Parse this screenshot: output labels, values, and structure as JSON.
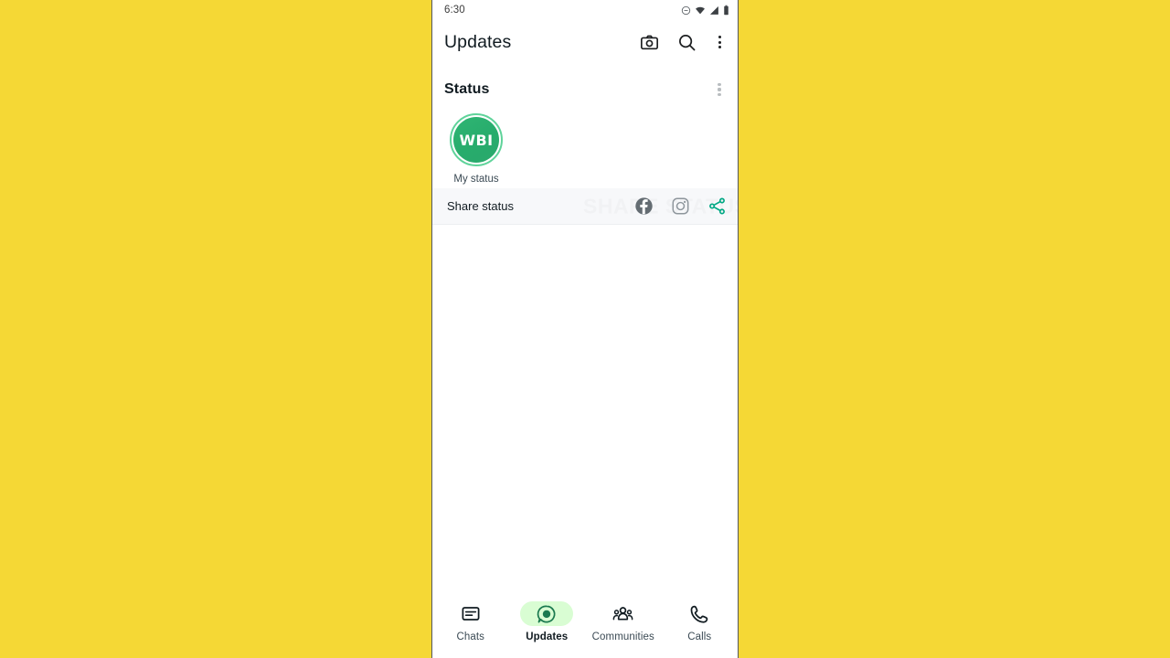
{
  "theme": {
    "page_background": "#f5d835",
    "phone_background": "#ffffff",
    "accent_green": "#00a884",
    "avatar_green": "#2aa86c",
    "active_pill_green": "#d9fdd3",
    "active_icon_green": "#1b7a4f",
    "text_primary": "#111b21",
    "text_secondary": "#3b4a54",
    "share_row_background": "#f7f8fa",
    "watermark_color": "#f1f2f4"
  },
  "statusbar": {
    "clock": "6:30",
    "icons": [
      "do-not-disturb-icon",
      "wifi-icon",
      "cellular-signal-icon",
      "battery-icon"
    ]
  },
  "appbar": {
    "title": "Updates",
    "actions": [
      {
        "name": "camera-icon",
        "label": "Camera"
      },
      {
        "name": "search-icon",
        "label": "Search"
      },
      {
        "name": "overflow-menu-icon",
        "label": "More options"
      }
    ]
  },
  "status_section": {
    "heading": "Status",
    "overflow_label": "Status options",
    "my_status": {
      "avatar_initials": "WBI",
      "label": "My status",
      "has_unseen_ring": true
    }
  },
  "share_row": {
    "label": "Share status",
    "watermark_text": "SHARE STATUS",
    "icons": [
      {
        "name": "facebook-icon",
        "label": "Share to Facebook",
        "color": "#646c72"
      },
      {
        "name": "instagram-icon",
        "label": "Share to Instagram",
        "color": "#8e969c"
      },
      {
        "name": "share-icon",
        "label": "Share to other apps",
        "color": "#00a884"
      }
    ]
  },
  "bottom_nav": {
    "active_index": 1,
    "items": [
      {
        "label": "Chats",
        "icon": "chats-icon"
      },
      {
        "label": "Updates",
        "icon": "updates-icon"
      },
      {
        "label": "Communities",
        "icon": "communities-icon"
      },
      {
        "label": "Calls",
        "icon": "calls-icon"
      }
    ]
  }
}
